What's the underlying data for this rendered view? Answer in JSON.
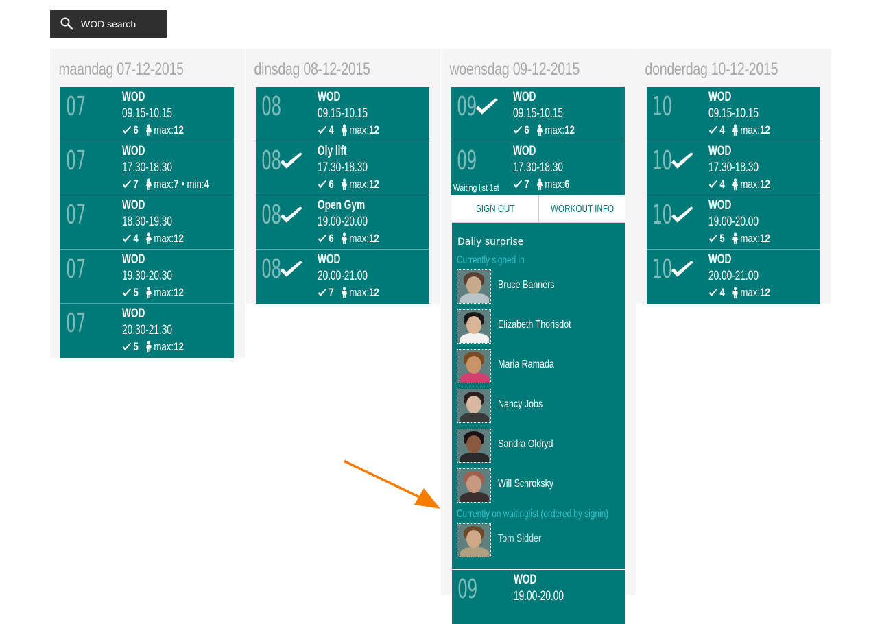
{
  "search_button": {
    "label": "WOD search",
    "icon": "search-icon"
  },
  "colors": {
    "teal": "#007a78",
    "hour_text": "#7ebab8",
    "accent_cyan": "#2fc0c6",
    "day_title": "#a9a9a9",
    "arrow": "#f57c00"
  },
  "days": [
    {
      "title": "maandag 07-12-2015",
      "slots": [
        {
          "hour": "07",
          "name": "WOD",
          "time": "09.15-10.15",
          "count": "6",
          "max": "12",
          "min": "",
          "checked": false
        },
        {
          "hour": "07",
          "name": "WOD",
          "time": "17.30-18.30",
          "count": "7",
          "max": "7",
          "min": "4",
          "checked": false
        },
        {
          "hour": "07",
          "name": "WOD",
          "time": "18.30-19.30",
          "count": "4",
          "max": "12",
          "min": "",
          "checked": false
        },
        {
          "hour": "07",
          "name": "WOD",
          "time": "19.30-20.30",
          "count": "5",
          "max": "12",
          "min": "",
          "checked": false
        },
        {
          "hour": "07",
          "name": "WOD",
          "time": "20.30-21.30",
          "count": "5",
          "max": "12",
          "min": "",
          "checked": false
        }
      ]
    },
    {
      "title": "dinsdag 08-12-2015",
      "slots": [
        {
          "hour": "08",
          "name": "WOD",
          "time": "09.15-10.15",
          "count": "4",
          "max": "12",
          "min": "",
          "checked": false
        },
        {
          "hour": "08",
          "name": "Oly lift",
          "time": "17.30-18.30",
          "count": "6",
          "max": "12",
          "min": "",
          "checked": true
        },
        {
          "hour": "08",
          "name": "Open Gym",
          "time": "19.00-20.00",
          "count": "6",
          "max": "12",
          "min": "",
          "checked": true
        },
        {
          "hour": "08",
          "name": "WOD",
          "time": "20.00-21.00",
          "count": "7",
          "max": "12",
          "min": "",
          "checked": true
        }
      ]
    },
    {
      "title": "woensdag 09-12-2015",
      "slots": [
        {
          "hour": "09",
          "name": "WOD",
          "time": "09.15-10.15",
          "count": "6",
          "max": "12",
          "min": "",
          "checked": true
        },
        {
          "hour": "09",
          "name": "WOD",
          "time": "17.30-18.30",
          "count": "7",
          "max": "6",
          "min": "",
          "checked": false,
          "wait_label": "Waiting list 1st"
        }
      ]
    },
    {
      "title": "donderdag 10-12-2015",
      "slots": [
        {
          "hour": "10",
          "name": "WOD",
          "time": "09.15-10.15",
          "count": "4",
          "max": "12",
          "min": "",
          "checked": false
        },
        {
          "hour": "10",
          "name": "WOD",
          "time": "17.30-18.30",
          "count": "4",
          "max": "12",
          "min": "",
          "checked": true
        },
        {
          "hour": "10",
          "name": "WOD",
          "time": "19.00-20.00",
          "count": "5",
          "max": "12",
          "min": "",
          "checked": true
        },
        {
          "hour": "10",
          "name": "WOD",
          "time": "20.00-21.00",
          "count": "4",
          "max": "12",
          "min": "",
          "checked": true
        }
      ]
    }
  ],
  "labels": {
    "max": "max:",
    "min": "min:"
  },
  "detail": {
    "sign_out": "SIGN OUT",
    "workout_info": "WORKOUT INFO",
    "title": "Daily surprise",
    "signed_in_heading": "Currently signed in",
    "signed_in": [
      "Bruce Banners",
      "Elizabeth Thorisdot",
      "Maria Ramada",
      "Nancy Jobs",
      "Sandra Oldryd",
      "Will Schroksky"
    ],
    "waiting_heading": "Currently on waitinglist (ordered by signin)",
    "waiting": [
      "Tom Sidder"
    ]
  },
  "next_slot": {
    "hour": "09",
    "name": "WOD",
    "time": "19.00-20.00"
  }
}
